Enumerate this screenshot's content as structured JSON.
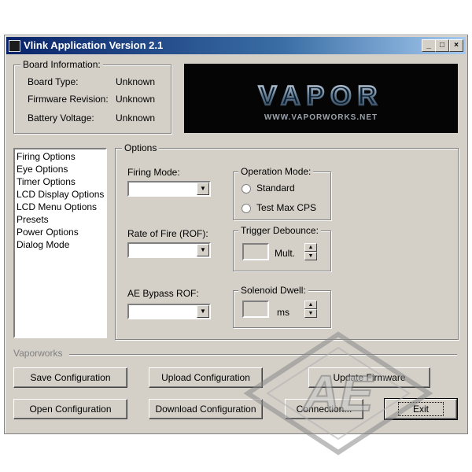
{
  "window": {
    "title": "Vlink Application Version 2.1",
    "controls": [
      "_",
      "□",
      "×"
    ]
  },
  "board_info": {
    "legend": "Board Information:",
    "rows": [
      {
        "label": "Board Type:",
        "value": "Unknown"
      },
      {
        "label": "Firmware Revision:",
        "value": "Unknown"
      },
      {
        "label": "Battery Voltage:",
        "value": "Unknown"
      }
    ]
  },
  "logo": {
    "text": "VAPOR",
    "url": "WWW.VAPORWORKS.NET"
  },
  "nav_list": [
    "Firing Options",
    "Eye Options",
    "Timer Options",
    "LCD Display Options",
    "LCD Menu Options",
    "Presets",
    "Power Options",
    "Dialog Mode"
  ],
  "options": {
    "legend": "Options",
    "firing_mode": {
      "label": "Firing Mode:",
      "value": ""
    },
    "rof": {
      "label": "Rate of Fire (ROF):",
      "value": ""
    },
    "ae_bypass": {
      "label": "AE Bypass ROF:",
      "value": ""
    },
    "operation_mode": {
      "legend": "Operation Mode:",
      "options": [
        "Standard",
        "Test Max CPS"
      ]
    },
    "trigger_debounce": {
      "legend": "Trigger Debounce:",
      "unit": "Mult.",
      "value": ""
    },
    "solenoid_dwell": {
      "legend": "Solenoid Dwell:",
      "unit": "ms",
      "value": ""
    }
  },
  "footer": {
    "label": "Vaporworks"
  },
  "buttons": {
    "save": "Save Configuration",
    "upload": "Upload Configuration",
    "update": "Update Firmware",
    "open": "Open Configuration",
    "download": "Download Configuration",
    "connection": "Connection...",
    "exit": "Exit"
  },
  "watermark": {
    "text": "AE"
  }
}
